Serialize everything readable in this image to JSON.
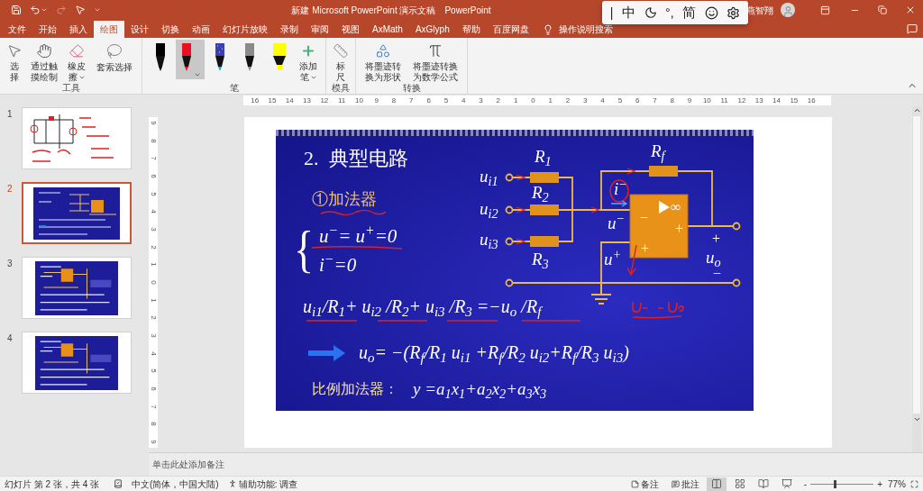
{
  "title_bar": {
    "redo_disabled": true,
    "title": "新建 Microsoft PowerPoint 演示文稿",
    "app": "PowerPoint",
    "user": "燕智翔"
  },
  "ime_toolbar": {
    "cursor": "|",
    "mode": "中",
    "punctuation": "°,",
    "script": "简"
  },
  "tabs": [
    {
      "label": "文件",
      "selected": false
    },
    {
      "label": "开始",
      "selected": false
    },
    {
      "label": "插入",
      "selected": false
    },
    {
      "label": "绘图",
      "selected": true
    },
    {
      "label": "设计",
      "selected": false
    },
    {
      "label": "切换",
      "selected": false
    },
    {
      "label": "动画",
      "selected": false
    },
    {
      "label": "幻灯片放映",
      "selected": false
    },
    {
      "label": "录制",
      "selected": false
    },
    {
      "label": "审阅",
      "selected": false
    },
    {
      "label": "视图",
      "selected": false
    },
    {
      "label": "AxMath",
      "selected": false
    },
    {
      "label": "AxGlyph",
      "selected": false
    },
    {
      "label": "帮助",
      "selected": false
    },
    {
      "label": "百度网盘",
      "selected": false
    }
  ],
  "search": {
    "placeholder": "操作说明搜索"
  },
  "ribbon": {
    "groups": [
      {
        "label": "工具",
        "items": [
          {
            "kind": "select",
            "label": "选择"
          },
          {
            "kind": "touch",
            "label": "通过触摸绘制"
          },
          {
            "kind": "eraser",
            "label": "橡皮擦"
          },
          {
            "kind": "lasso",
            "label": "套索选择"
          }
        ]
      },
      {
        "label": "笔",
        "pens": [
          {
            "kind": "pen",
            "color": "#000000",
            "selected": false
          },
          {
            "kind": "pen",
            "color": "#e81123",
            "selected": true
          },
          {
            "kind": "galaxy",
            "color": "#3b3fb0",
            "selected": false
          },
          {
            "kind": "pen",
            "color": "#8a8a8a",
            "selected": false
          },
          {
            "kind": "highlighter",
            "color": "#ffff00",
            "selected": false
          }
        ],
        "items": [
          {
            "kind": "add_pen",
            "label": "添加笔"
          }
        ]
      },
      {
        "label": "模具",
        "items": [
          {
            "kind": "ruler",
            "label": "标尺"
          }
        ]
      },
      {
        "label": "转换",
        "items": [
          {
            "kind": "ink_to_shape",
            "label": "将墨迹转换为形状"
          },
          {
            "kind": "ink_to_math",
            "label": "将墨迹转换为数学公式"
          }
        ]
      }
    ]
  },
  "thumbnails": [
    {
      "number": "1",
      "kind": "sketch",
      "selected": false
    },
    {
      "number": "2",
      "kind": "adder",
      "selected": true
    },
    {
      "number": "3",
      "kind": "blue",
      "selected": false
    },
    {
      "number": "4",
      "kind": "blue",
      "selected": false
    }
  ],
  "rulers": {
    "horizontal": [
      "16",
      "15",
      "14",
      "13",
      "12",
      "11",
      "10",
      "9",
      "8",
      "7",
      "6",
      "5",
      "4",
      "3",
      "2",
      "1",
      "0",
      "1",
      "2",
      "3",
      "4",
      "5",
      "6",
      "7",
      "8",
      "9",
      "10",
      "11",
      "12",
      "13",
      "14",
      "15",
      "16"
    ],
    "vertical": [
      "9",
      "8",
      "7",
      "6",
      "5",
      "4",
      "3",
      "2",
      "1",
      "0",
      "1",
      "2",
      "3",
      "4",
      "5",
      "6",
      "7",
      "8",
      "9"
    ]
  },
  "slide": {
    "title": "2.  典型电路",
    "subtitle": "①加法器",
    "brace": "{",
    "conditions": [
      "u$^{−}$= u$^{+}$=0",
      "i$^{−}$=0"
    ],
    "circuit": {
      "r1": "R$_{1}$",
      "r2": "R$_{2}$",
      "r3": "R$_{3}$",
      "rf": "R$_{f}$",
      "u_i1": "u$_{i1}$",
      "u_i2": "u$_{i2}$",
      "u_i3": "u$_{i3}$",
      "i_minus": "i$^{−}$",
      "u_minus": "u$^{−}$",
      "u_plus": "u$^{+}$",
      "gain": "∞",
      "inverting": "−",
      "noninverting": "+",
      "opamp_output": "+",
      "out_plus": "+",
      "out_label": "u$_{o}$",
      "out_minus": "−"
    },
    "equation": "u$_{i1}$/R$_{1}$+ u$_{i2}$ /R$_{2}$+ u$_{i3}$ /R$_{3}$ =−u$_{o}$ /R$_{f}$",
    "result": "u$_{o}$= −(R$_{f}$/R$_{1}$ u$_{i1}$ +R$_{f}$/R$_{2}$ u$_{i2}$+R$_{f}$/R$_{3}$ u$_{i3}$)",
    "proportional_label": "比例加法器：",
    "proportional_formula": "y =a$_{1}$x$_{1}$+a$_{2}$x$_{2}$+a$_{3}$x$_{3}$"
  },
  "notes": {
    "placeholder": "单击此处添加备注"
  },
  "status_bar": {
    "slide_info": "幻灯片 第 2 张，共 4 张",
    "language": "中文(简体，中国大陆)",
    "accessibility": "辅助功能: 调查",
    "notes": "备注",
    "comments": "批注",
    "views": [
      {
        "kind": "normal",
        "selected": true
      },
      {
        "kind": "sorter",
        "selected": false
      },
      {
        "kind": "reading",
        "selected": false
      },
      {
        "kind": "slideshow",
        "selected": false
      }
    ],
    "zoom": {
      "minus": "-",
      "plus": "+",
      "level": 0.38,
      "reading": "77%"
    }
  }
}
